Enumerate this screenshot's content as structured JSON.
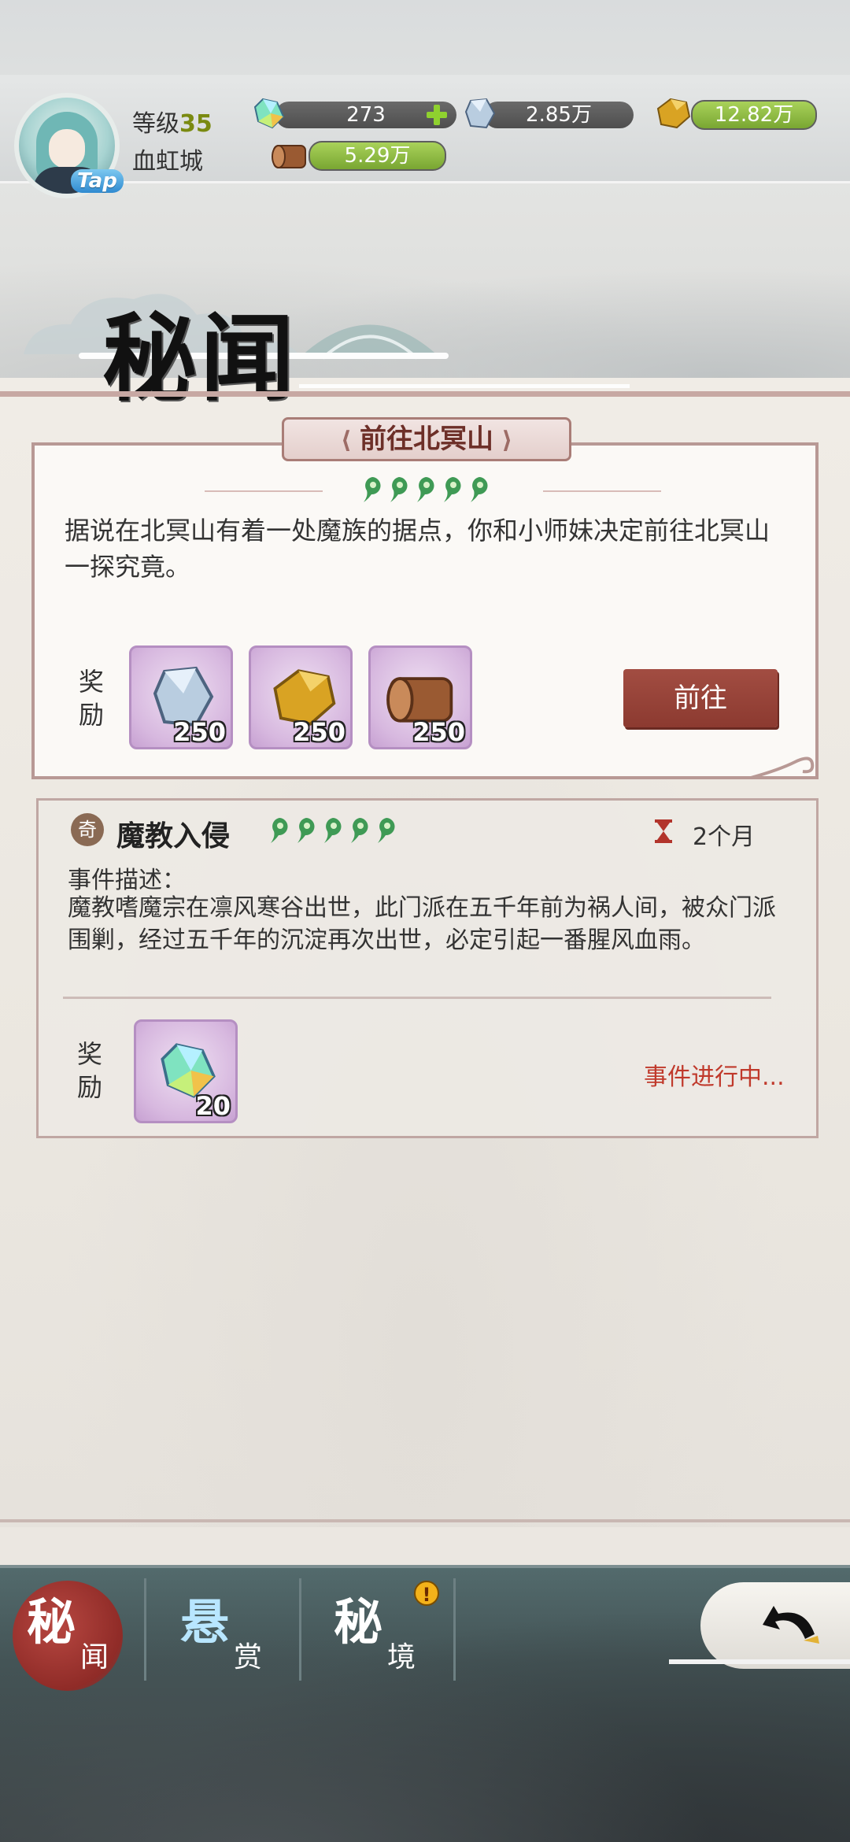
{
  "player": {
    "level_label": "等级",
    "level_value": "35",
    "city": "血虹城",
    "avatar_badge": "Tap"
  },
  "resources": [
    {
      "icon": "rainbow-crystal-icon",
      "value": "273",
      "has_add": true
    },
    {
      "icon": "ice-crystal-icon",
      "value": "2.85万"
    },
    {
      "icon": "gold-ore-icon",
      "value": "12.82万"
    },
    {
      "icon": "wood-log-icon",
      "value": "5.29万"
    }
  ],
  "page": {
    "title": "秘闻"
  },
  "featured_event": {
    "title": "前往北冥山",
    "difficulty": 5,
    "description": "据说在北冥山有着一处魔族的据点，你和小师妹决定前往北冥山一探究竟。",
    "reward_label": "奖励",
    "rewards": [
      {
        "icon": "ice-crystal-icon",
        "count": "250"
      },
      {
        "icon": "gold-ore-icon",
        "count": "250"
      },
      {
        "icon": "wood-log-icon",
        "count": "250"
      }
    ],
    "go_button": "前往"
  },
  "ongoing_event": {
    "badge": "奇",
    "title": "魔教入侵",
    "difficulty": 5,
    "duration": "2个月",
    "desc_label": "事件描述：",
    "description": "魔教嗜魔宗在凛风寒谷出世，此门派在五千年前为祸人间，被众门派围剿，经过五千年的沉淀再次出世，必定引起一番腥风血雨。",
    "reward_label": "奖励",
    "rewards": [
      {
        "icon": "rainbow-crystal-icon",
        "count": "20"
      }
    ],
    "status": "事件进行中..."
  },
  "nav": {
    "tabs": [
      {
        "main": "秘",
        "sub": "闻",
        "active": true
      },
      {
        "main": "悬",
        "sub": "赏",
        "active": false
      },
      {
        "main": "秘",
        "sub": "境",
        "active": false,
        "alert": "!"
      }
    ],
    "back_icon": "back-arrow-icon"
  },
  "colors": {
    "accent_red": "#8c3a30",
    "card_border": "#b89995",
    "status_red": "#c0392b",
    "level_green": "#7a8a10"
  }
}
